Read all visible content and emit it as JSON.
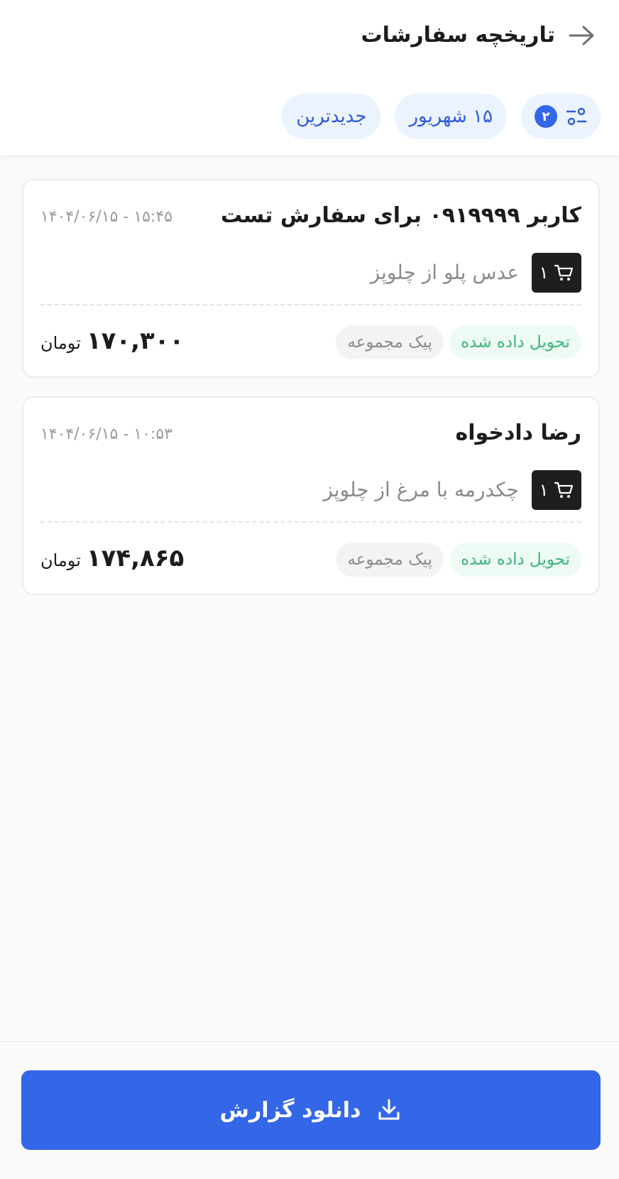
{
  "header": {
    "title": "تاریخچه سفارشات",
    "back_icon": "arrow-right-icon",
    "filters": {
      "filter_icon": "filter-sliders-icon",
      "filter_count": "۲",
      "date_chip": "۱۵ شهریور",
      "sort_chip": "جدیدترین"
    }
  },
  "orders": [
    {
      "customer": "کاربر ۰۹۱۹۹۹۹ برای سفارش تست",
      "time": "۱۴۰۴/۰۶/۱۵ - ۱۵:۴۵",
      "quantity": "۱",
      "item": "عدس پلو از چلوپز",
      "status": "تحویل داده شده",
      "delivery": "پیک مجموعه",
      "price": "۱۷۰,۳۰۰",
      "currency": "تومان"
    },
    {
      "customer": "رضا دادخواه",
      "time": "۱۴۰۴/۰۶/۱۵ - ۱۰:۵۳",
      "quantity": "۱",
      "item": "چکدرمه با مرغ از چلوپز",
      "status": "تحویل داده شده",
      "delivery": "پیک مجموعه",
      "price": "۱۷۴,۸۶۵",
      "currency": "تومان"
    }
  ],
  "footer": {
    "download_label": "دانلود گزارش",
    "download_icon": "download-icon"
  },
  "colors": {
    "primary": "#3466e8",
    "chip_bg": "#ebf3fe",
    "chip_text": "#2f5bd8",
    "status_green": "#3cb57a",
    "status_green_bg": "#eefbf4"
  }
}
